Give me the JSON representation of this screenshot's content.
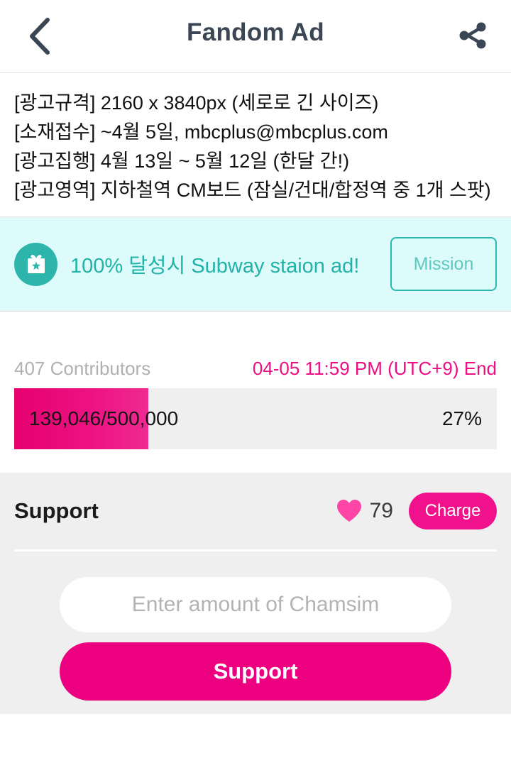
{
  "header": {
    "title": "Fandom Ad",
    "back_icon": "chevron-left-icon",
    "share_icon": "share-icon"
  },
  "description": {
    "text": "[광고규격] 2160 x 3840px (세로로 긴 사이즈)\n[소재접수] ~4월 5일, mbcplus@mbcplus.com\n[광고집행] 4월 13일 ~ 5월 12일 (한달 간!)\n[광고영역] 지하철역 CM보드 (잠실/건대/합정역 중 1개 스팟)"
  },
  "mission_banner": {
    "gift_icon": "gift-icon",
    "text": "100% 달성시 Subway staion ad!",
    "button_label": "Mission",
    "bg_color": "#ddfbfb",
    "accent_color": "#22b3a8"
  },
  "progress": {
    "contributors": "407 Contributors",
    "deadline": "04-05 11:59 PM (UTC+9) End",
    "amount": "139,046/500,000",
    "percent_label": "27%",
    "current": 139046,
    "goal": 500000,
    "percent": 27,
    "fill_color": "#ec0080",
    "track_color": "#efefef"
  },
  "support": {
    "title": "Support",
    "heart_icon": "heart-icon",
    "chamsim_balance": "79",
    "charge_label": "Charge",
    "input_placeholder": "Enter amount of Chamsim",
    "input_value": "",
    "submit_label": "Support",
    "accent_color": "#ec007f"
  }
}
